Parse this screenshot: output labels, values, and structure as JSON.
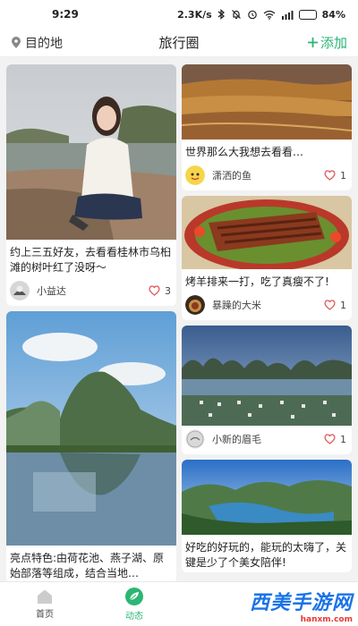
{
  "status_bar": {
    "time": "9:29",
    "network_speed": "2.3K/s",
    "battery": "84",
    "battery_level": 0.84
  },
  "header": {
    "location_label": "目的地",
    "title": "旅行圈",
    "add_label": "添加",
    "accent_color": "#2bb673"
  },
  "feed": {
    "left": [
      {
        "caption": "约上三五好友，去看看桂林市乌桕滩的树叶红了没呀～",
        "user": "小益达",
        "likes": "3"
      },
      {
        "caption": "亮点特色:由荷花池、燕子湖、原始部落等组成，结合当地…"
      }
    ],
    "right": [
      {
        "caption": "世界那么大我想去看看…",
        "user": "潇洒的鱼",
        "likes": "1"
      },
      {
        "caption": "烤羊排来一打，吃了真瘦不了!",
        "user": "暴躁的大米",
        "likes": "1"
      },
      {
        "user": "小新的眉毛",
        "likes": "1"
      },
      {
        "caption": "好吃的好玩的，能玩的太嗨了，关键是少了个美女陪伴!"
      }
    ]
  },
  "tabs": [
    {
      "label": "首页",
      "icon": "home-icon"
    },
    {
      "label": "动态",
      "icon": "leaf-icon",
      "active": true
    }
  ],
  "watermark": {
    "text": "西美手游网",
    "url": "hanxm.com"
  }
}
